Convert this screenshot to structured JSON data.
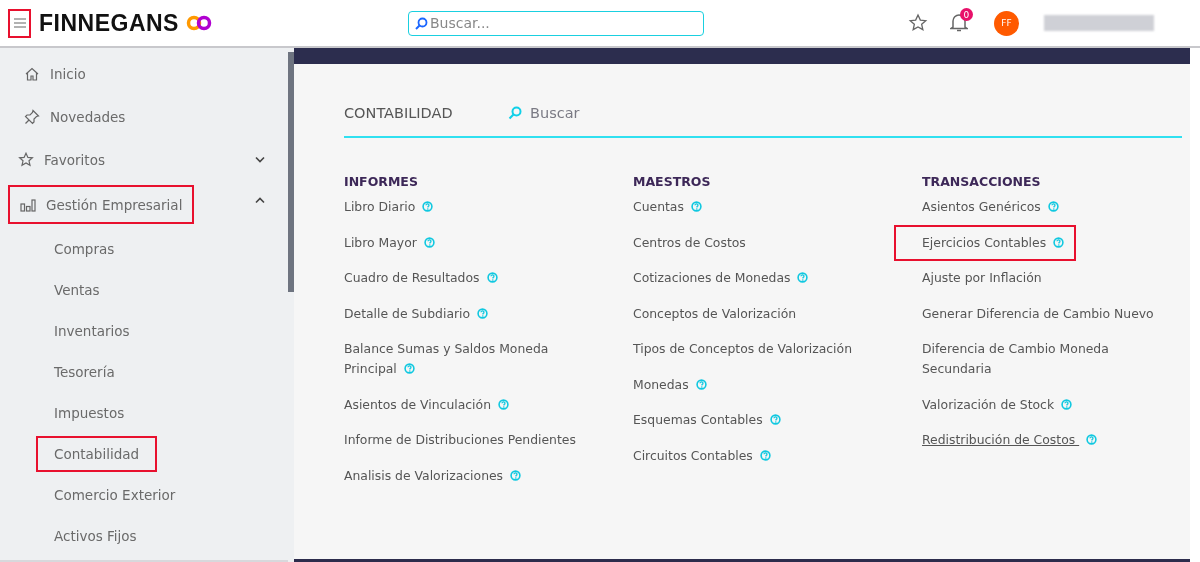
{
  "header": {
    "menu_highlighted": true,
    "logo": "FINNEGANS",
    "search": {
      "placeholder": "Buscar..."
    },
    "notification_count": "0",
    "avatar": "FF"
  },
  "sidebar": {
    "items": [
      {
        "label": "Inicio",
        "kind": "home",
        "highlighted": false
      },
      {
        "label": "Novedades",
        "kind": "pin",
        "highlighted": false
      },
      {
        "label": "Favoritos",
        "kind": "star",
        "expanded": false,
        "highlighted": false
      },
      {
        "label": "Gestión Empresarial",
        "kind": "chart",
        "expanded": true,
        "highlighted": true,
        "children": [
          {
            "label": "Compras",
            "highlighted": false
          },
          {
            "label": "Ventas",
            "highlighted": false
          },
          {
            "label": "Inventarios",
            "highlighted": false
          },
          {
            "label": "Tesorería",
            "highlighted": false
          },
          {
            "label": "Impuestos",
            "highlighted": false
          },
          {
            "label": "Contabilidad",
            "highlighted": true
          },
          {
            "label": "Comercio Exterior",
            "highlighted": false
          },
          {
            "label": "Activos Fijos",
            "highlighted": false
          }
        ]
      }
    ]
  },
  "content": {
    "title": "CONTABILIDAD",
    "search": {
      "placeholder": "Buscar"
    },
    "columns": [
      {
        "heading": "INFORMES",
        "items": [
          {
            "label": "Libro Diario",
            "help": true,
            "highlighted": false
          },
          {
            "label": "Libro Mayor",
            "help": true,
            "highlighted": false
          },
          {
            "label": "Cuadro de Resultados",
            "help": true,
            "highlighted": false
          },
          {
            "label": "Detalle de Subdiario",
            "help": true,
            "highlighted": false
          },
          {
            "label": "Balance Sumas y Saldos Moneda Principal",
            "help": true,
            "highlighted": false
          },
          {
            "label": "Asientos de Vinculación",
            "help": true,
            "highlighted": false
          },
          {
            "label": "Informe de Distribuciones Pendientes",
            "help": false,
            "highlighted": false
          },
          {
            "label": "Analisis de Valorizaciones",
            "help": true,
            "highlighted": false
          }
        ]
      },
      {
        "heading": "MAESTROS",
        "items": [
          {
            "label": "Cuentas",
            "help": true,
            "highlighted": false
          },
          {
            "label": "Centros de Costos",
            "help": false,
            "highlighted": false
          },
          {
            "label": "Cotizaciones de Monedas",
            "help": true,
            "highlighted": false
          },
          {
            "label": "Conceptos de Valorización",
            "help": false,
            "highlighted": false
          },
          {
            "label": "Tipos de Conceptos de Valorización",
            "help": false,
            "highlighted": false
          },
          {
            "label": "Monedas",
            "help": true,
            "highlighted": false
          },
          {
            "label": "Esquemas Contables",
            "help": true,
            "highlighted": false
          },
          {
            "label": "Circuitos Contables",
            "help": true,
            "highlighted": false
          }
        ]
      },
      {
        "heading": "TRANSACCIONES",
        "items": [
          {
            "label": "Asientos Genéricos",
            "help": true,
            "highlighted": false
          },
          {
            "label": "Ejercicios Contables",
            "help": true,
            "highlighted": true
          },
          {
            "label": "Ajuste por Inflación",
            "help": false,
            "highlighted": false
          },
          {
            "label": "Generar Diferencia de Cambio Nuevo",
            "help": false,
            "highlighted": false
          },
          {
            "label": "Diferencia de Cambio Moneda Secundaria",
            "help": false,
            "highlighted": false
          },
          {
            "label": "Valorización de Stock",
            "help": true,
            "highlighted": false
          },
          {
            "label": "Redistribución de Costos ",
            "help": true,
            "highlighted": false,
            "underlined": true
          }
        ]
      }
    ]
  }
}
